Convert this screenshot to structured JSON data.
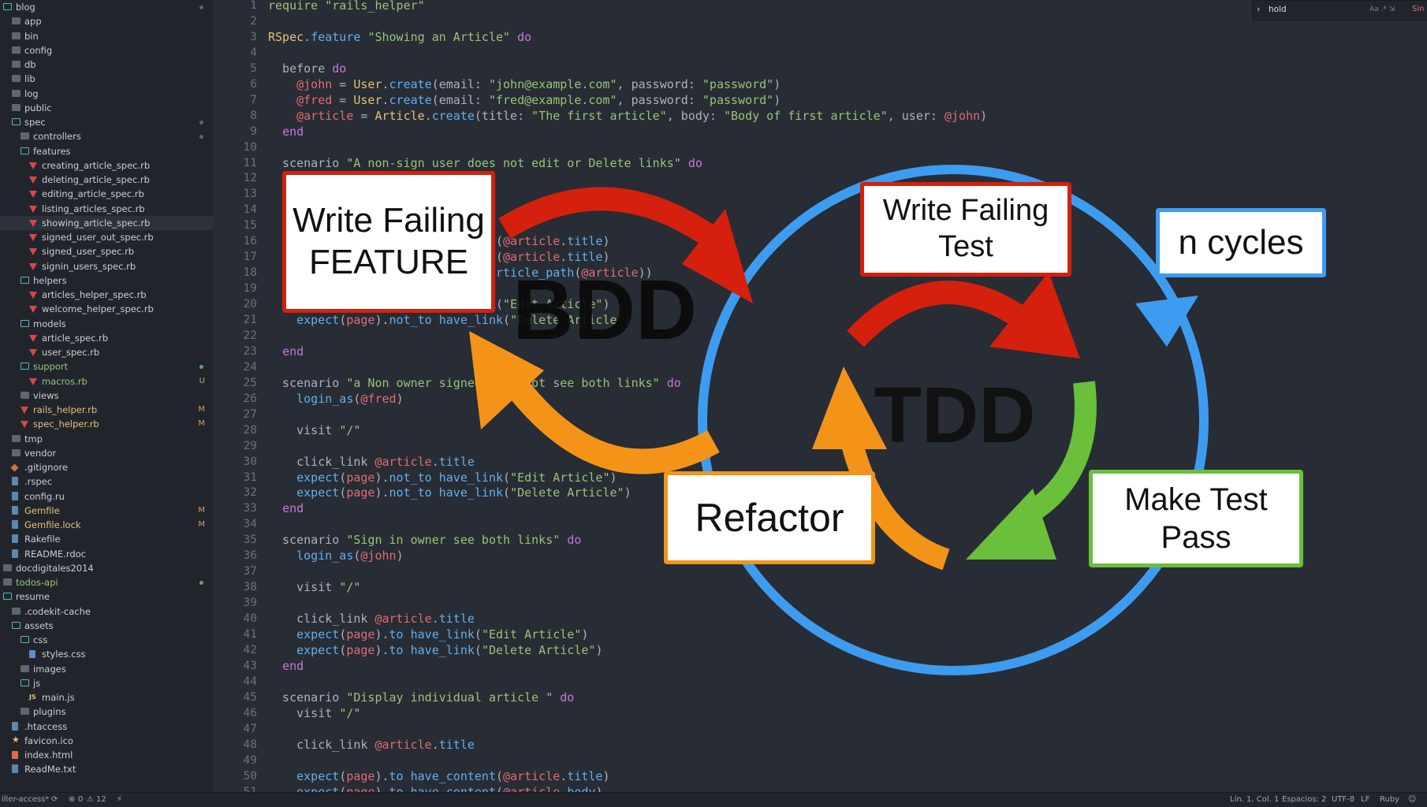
{
  "sidebar": {
    "items": [
      {
        "label": "blog",
        "icon": "folder-open-icon",
        "indent": 0,
        "open": true,
        "dot": "gray"
      },
      {
        "label": "app",
        "icon": "folder-icon",
        "indent": 1
      },
      {
        "label": "bin",
        "icon": "folder-icon",
        "indent": 1
      },
      {
        "label": "config",
        "icon": "folder-icon",
        "indent": 1
      },
      {
        "label": "db",
        "icon": "folder-icon",
        "indent": 1
      },
      {
        "label": "lib",
        "icon": "folder-icon",
        "indent": 1
      },
      {
        "label": "log",
        "icon": "folder-icon",
        "indent": 1
      },
      {
        "label": "public",
        "icon": "folder-icon",
        "indent": 1
      },
      {
        "label": "spec",
        "icon": "folder-open-icon",
        "indent": 1,
        "open": true,
        "dot": "gray"
      },
      {
        "label": "controllers",
        "icon": "folder-icon",
        "indent": 2,
        "dot": "gray"
      },
      {
        "label": "features",
        "icon": "folder-open-icon",
        "indent": 2,
        "open": true
      },
      {
        "label": "creating_article_spec.rb",
        "icon": "ruby-icon",
        "indent": 3
      },
      {
        "label": "deleting_article_spec.rb",
        "icon": "ruby-icon",
        "indent": 3
      },
      {
        "label": "editing_article_spec.rb",
        "icon": "ruby-icon",
        "indent": 3
      },
      {
        "label": "listing_articles_spec.rb",
        "icon": "ruby-icon",
        "indent": 3
      },
      {
        "label": "showing_article_spec.rb",
        "icon": "ruby-icon",
        "indent": 3,
        "selected": true
      },
      {
        "label": "signed_user_out_spec.rb",
        "icon": "ruby-icon",
        "indent": 3
      },
      {
        "label": "signed_user_spec.rb",
        "icon": "ruby-icon",
        "indent": 3
      },
      {
        "label": "signin_users_spec.rb",
        "icon": "ruby-icon",
        "indent": 3
      },
      {
        "label": "helpers",
        "icon": "folder-open-icon",
        "indent": 2,
        "open": true
      },
      {
        "label": "articles_helper_spec.rb",
        "icon": "ruby-icon",
        "indent": 3
      },
      {
        "label": "welcome_helper_spec.rb",
        "icon": "ruby-icon",
        "indent": 3
      },
      {
        "label": "models",
        "icon": "folder-open-icon",
        "indent": 2,
        "open": true
      },
      {
        "label": "article_spec.rb",
        "icon": "ruby-icon",
        "indent": 3
      },
      {
        "label": "user_spec.rb",
        "icon": "ruby-icon",
        "indent": 3
      },
      {
        "label": "support",
        "icon": "folder-open-icon",
        "indent": 2,
        "open": true,
        "green": true,
        "dot": "green"
      },
      {
        "label": "macros.rb",
        "icon": "ruby-icon",
        "indent": 3,
        "green": true,
        "badge": "U"
      },
      {
        "label": "views",
        "icon": "folder-icon",
        "indent": 2
      },
      {
        "label": "rails_helper.rb",
        "icon": "ruby-icon",
        "indent": 2,
        "badge": "M",
        "orange": true
      },
      {
        "label": "spec_helper.rb",
        "icon": "ruby-icon",
        "indent": 2,
        "badge": "M",
        "orange": true
      },
      {
        "label": "tmp",
        "icon": "folder-icon",
        "indent": 1
      },
      {
        "label": "vendor",
        "icon": "folder-icon",
        "indent": 1
      },
      {
        "label": ".gitignore",
        "icon": "git-icon",
        "indent": 1
      },
      {
        "label": ".rspec",
        "icon": "file-icon",
        "indent": 1
      },
      {
        "label": "config.ru",
        "icon": "file-icon",
        "indent": 1
      },
      {
        "label": "Gemfile",
        "icon": "file-icon",
        "indent": 1,
        "badge": "M",
        "orange": true
      },
      {
        "label": "Gemfile.lock",
        "icon": "file-icon",
        "indent": 1,
        "badge": "M",
        "orange": true
      },
      {
        "label": "Rakefile",
        "icon": "file-icon",
        "indent": 1
      },
      {
        "label": "README.rdoc",
        "icon": "file-icon",
        "indent": 1
      },
      {
        "label": "docdigitales2014",
        "icon": "folder-icon",
        "indent": 0
      },
      {
        "label": "todos-api",
        "icon": "folder-icon",
        "indent": 0,
        "green": true,
        "dot": "green"
      },
      {
        "label": "resume",
        "icon": "folder-open-icon",
        "indent": 0,
        "open": true
      },
      {
        "label": ".codekit-cache",
        "icon": "folder-icon",
        "indent": 1
      },
      {
        "label": "assets",
        "icon": "folder-open-icon",
        "indent": 1,
        "open": true
      },
      {
        "label": "css",
        "icon": "folder-open-icon",
        "indent": 2,
        "open": true
      },
      {
        "label": "styles.css",
        "icon": "css-icon",
        "indent": 3
      },
      {
        "label": "images",
        "icon": "folder-icon",
        "indent": 2
      },
      {
        "label": "js",
        "icon": "folder-open-icon",
        "indent": 2,
        "open": true
      },
      {
        "label": "main.js",
        "icon": "js-icon",
        "indent": 3
      },
      {
        "label": "plugins",
        "icon": "folder-icon",
        "indent": 2
      },
      {
        "label": ".htaccess",
        "icon": "file-icon",
        "indent": 1
      },
      {
        "label": "favicon.ico",
        "icon": "star-icon",
        "indent": 1
      },
      {
        "label": "index.html",
        "icon": "html-icon",
        "indent": 1
      },
      {
        "label": "ReadMe.txt",
        "icon": "file-icon",
        "indent": 1
      }
    ]
  },
  "findbar": {
    "query": "hold",
    "options": "Aa  .*  ⇲",
    "results": "Sin resultados",
    "prev": "←",
    "next": "→",
    "select_all": "≡",
    "close": "✕"
  },
  "code": {
    "lines": [
      [
        [
          "str",
          "require \"rails_helper\""
        ]
      ],
      [],
      [
        [
          "const",
          "RSpec"
        ],
        [
          "txt",
          "."
        ],
        [
          "fn",
          "feature"
        ],
        [
          "txt",
          " "
        ],
        [
          "str",
          "\"Showing an Article\""
        ],
        [
          "txt",
          " "
        ],
        [
          "kw",
          "do"
        ]
      ],
      [],
      [
        [
          "txt",
          "  before "
        ],
        [
          "kw",
          "do"
        ]
      ],
      [
        [
          "txt",
          "    "
        ],
        [
          "iv",
          "@john"
        ],
        [
          "txt",
          " = "
        ],
        [
          "const",
          "User"
        ],
        [
          "txt",
          "."
        ],
        [
          "fn",
          "create"
        ],
        [
          "txt",
          "(email: "
        ],
        [
          "str",
          "\"john@example.com\""
        ],
        [
          "txt",
          ", password: "
        ],
        [
          "str",
          "\"password\""
        ],
        [
          "txt",
          ")"
        ]
      ],
      [
        [
          "txt",
          "    "
        ],
        [
          "iv",
          "@fred"
        ],
        [
          "txt",
          " = "
        ],
        [
          "const",
          "User"
        ],
        [
          "txt",
          "."
        ],
        [
          "fn",
          "create"
        ],
        [
          "txt",
          "(email: "
        ],
        [
          "str",
          "\"fred@example.com\""
        ],
        [
          "txt",
          ", password: "
        ],
        [
          "str",
          "\"password\""
        ],
        [
          "txt",
          ")"
        ]
      ],
      [
        [
          "txt",
          "    "
        ],
        [
          "iv",
          "@article"
        ],
        [
          "txt",
          " = "
        ],
        [
          "const",
          "Article"
        ],
        [
          "txt",
          "."
        ],
        [
          "fn",
          "create"
        ],
        [
          "txt",
          "(title: "
        ],
        [
          "str",
          "\"The first article\""
        ],
        [
          "txt",
          ", body: "
        ],
        [
          "str",
          "\"Body of first article\""
        ],
        [
          "txt",
          ", user: "
        ],
        [
          "iv",
          "@john"
        ],
        [
          "txt",
          ")"
        ]
      ],
      [
        [
          "txt",
          "  "
        ],
        [
          "kw",
          "end"
        ]
      ],
      [],
      [
        [
          "txt",
          "  scenario "
        ],
        [
          "str",
          "\"A non-sign user does not edit or Delete links\""
        ],
        [
          "txt",
          " "
        ],
        [
          "kw",
          "do"
        ]
      ],
      [],
      [],
      [],
      [],
      [
        [
          "txt",
          "                               t("
        ],
        [
          "iv",
          "@article"
        ],
        [
          "txt",
          "."
        ],
        [
          "fn",
          "title"
        ],
        [
          "txt",
          ")"
        ]
      ],
      [
        [
          "txt",
          "                               t("
        ],
        [
          "iv",
          "@article"
        ],
        [
          "txt",
          "."
        ],
        [
          "fn",
          "title"
        ],
        [
          "txt",
          ")"
        ]
      ],
      [
        [
          "txt",
          "                               "
        ],
        [
          "fn",
          "article_path"
        ],
        [
          "txt",
          "("
        ],
        [
          "iv",
          "@article"
        ],
        [
          "txt",
          "))"
        ]
      ],
      [],
      [
        [
          "txt",
          "                              nk("
        ],
        [
          "str",
          "\"Edit Article\""
        ],
        [
          "txt",
          ")"
        ]
      ],
      [
        [
          "txt",
          "    "
        ],
        [
          "fn",
          "expect"
        ],
        [
          "txt",
          "("
        ],
        [
          "iv",
          "page"
        ],
        [
          "txt",
          ")."
        ],
        [
          "fn",
          "not_to"
        ],
        [
          "txt",
          " "
        ],
        [
          "fn",
          "have_link"
        ],
        [
          "txt",
          "("
        ],
        [
          "str",
          "\"Delete Article\""
        ],
        [
          "txt",
          ")"
        ]
      ],
      [],
      [
        [
          "txt",
          "  "
        ],
        [
          "kw",
          "end"
        ]
      ],
      [],
      [
        [
          "txt",
          "  scenario "
        ],
        [
          "str",
          "\"a Non owner signed user not see both links\""
        ],
        [
          "txt",
          " "
        ],
        [
          "kw",
          "do"
        ]
      ],
      [
        [
          "txt",
          "    "
        ],
        [
          "fn",
          "login_as"
        ],
        [
          "txt",
          "("
        ],
        [
          "iv",
          "@fred"
        ],
        [
          "txt",
          ")"
        ]
      ],
      [],
      [
        [
          "txt",
          "    visit "
        ],
        [
          "str",
          "\"/\""
        ]
      ],
      [],
      [
        [
          "txt",
          "    click_link "
        ],
        [
          "iv",
          "@article"
        ],
        [
          "txt",
          "."
        ],
        [
          "fn",
          "title"
        ]
      ],
      [
        [
          "txt",
          "    "
        ],
        [
          "fn",
          "expect"
        ],
        [
          "txt",
          "("
        ],
        [
          "iv",
          "page"
        ],
        [
          "txt",
          ")."
        ],
        [
          "fn",
          "not_to"
        ],
        [
          "txt",
          " "
        ],
        [
          "fn",
          "have_link"
        ],
        [
          "txt",
          "("
        ],
        [
          "str",
          "\"Edit Article\""
        ],
        [
          "txt",
          ")"
        ]
      ],
      [
        [
          "txt",
          "    "
        ],
        [
          "fn",
          "expect"
        ],
        [
          "txt",
          "("
        ],
        [
          "iv",
          "page"
        ],
        [
          "txt",
          ")."
        ],
        [
          "fn",
          "not_to"
        ],
        [
          "txt",
          " "
        ],
        [
          "fn",
          "have_link"
        ],
        [
          "txt",
          "("
        ],
        [
          "str",
          "\"Delete Article\""
        ],
        [
          "txt",
          ")"
        ]
      ],
      [
        [
          "txt",
          "  "
        ],
        [
          "kw",
          "end"
        ]
      ],
      [],
      [
        [
          "txt",
          "  scenario "
        ],
        [
          "str",
          "\"Sign in owner see both links\""
        ],
        [
          "txt",
          " "
        ],
        [
          "kw",
          "do"
        ]
      ],
      [
        [
          "txt",
          "    "
        ],
        [
          "fn",
          "login_as"
        ],
        [
          "txt",
          "("
        ],
        [
          "iv",
          "@john"
        ],
        [
          "txt",
          ")"
        ]
      ],
      [],
      [
        [
          "txt",
          "    visit "
        ],
        [
          "str",
          "\"/\""
        ]
      ],
      [],
      [
        [
          "txt",
          "    click_link "
        ],
        [
          "iv",
          "@article"
        ],
        [
          "txt",
          "."
        ],
        [
          "fn",
          "title"
        ]
      ],
      [
        [
          "txt",
          "    "
        ],
        [
          "fn",
          "expect"
        ],
        [
          "txt",
          "("
        ],
        [
          "iv",
          "page"
        ],
        [
          "txt",
          ")."
        ],
        [
          "fn",
          "to"
        ],
        [
          "txt",
          " "
        ],
        [
          "fn",
          "have_link"
        ],
        [
          "txt",
          "("
        ],
        [
          "str",
          "\"Edit Article\""
        ],
        [
          "txt",
          ")"
        ]
      ],
      [
        [
          "txt",
          "    "
        ],
        [
          "fn",
          "expect"
        ],
        [
          "txt",
          "("
        ],
        [
          "iv",
          "page"
        ],
        [
          "txt",
          ")."
        ],
        [
          "fn",
          "to"
        ],
        [
          "txt",
          " "
        ],
        [
          "fn",
          "have_link"
        ],
        [
          "txt",
          "("
        ],
        [
          "str",
          "\"Delete Article\""
        ],
        [
          "txt",
          ")"
        ]
      ],
      [
        [
          "txt",
          "  "
        ],
        [
          "kw",
          "end"
        ]
      ],
      [],
      [
        [
          "txt",
          "  scenario "
        ],
        [
          "str",
          "\"Display individual article \""
        ],
        [
          "txt",
          " "
        ],
        [
          "kw",
          "do"
        ]
      ],
      [
        [
          "txt",
          "    visit "
        ],
        [
          "str",
          "\"/\""
        ]
      ],
      [],
      [
        [
          "txt",
          "    click_link "
        ],
        [
          "iv",
          "@article"
        ],
        [
          "txt",
          "."
        ],
        [
          "fn",
          "title"
        ]
      ],
      [],
      [
        [
          "txt",
          "    "
        ],
        [
          "fn",
          "expect"
        ],
        [
          "txt",
          "("
        ],
        [
          "iv",
          "page"
        ],
        [
          "txt",
          ")."
        ],
        [
          "fn",
          "to"
        ],
        [
          "txt",
          " "
        ],
        [
          "fn",
          "have_content"
        ],
        [
          "txt",
          "("
        ],
        [
          "iv",
          "@article"
        ],
        [
          "txt",
          "."
        ],
        [
          "fn",
          "title"
        ],
        [
          "txt",
          ")"
        ]
      ],
      [
        [
          "txt",
          "    "
        ],
        [
          "fn",
          "expect"
        ],
        [
          "txt",
          "("
        ],
        [
          "iv",
          "page"
        ],
        [
          "txt",
          ")."
        ],
        [
          "fn",
          "to"
        ],
        [
          "txt",
          " "
        ],
        [
          "fn",
          "have_content"
        ],
        [
          "txt",
          "("
        ],
        [
          "iv",
          "@article"
        ],
        [
          "txt",
          "."
        ],
        [
          "fn",
          "body"
        ],
        [
          "txt",
          ")"
        ]
      ]
    ]
  },
  "overlay": {
    "bdd_label": "BDD",
    "tdd_label": "TDD",
    "write_failing_feature": [
      "Write Failing",
      "FEATURE"
    ],
    "write_failing_test": [
      "Write Failing",
      "Test"
    ],
    "make_test_pass": [
      "Make Test",
      "Pass"
    ],
    "refactor": "Refactor",
    "n_cycles": "n cycles"
  },
  "statusbar": {
    "branch": "iller-access*",
    "errors": "0",
    "warnings": "12",
    "cursor": "Lín. 1, Col. 1",
    "indent": "Espacios: 2",
    "encoding": "UTF-8",
    "eol": "LF",
    "language": "Ruby"
  }
}
